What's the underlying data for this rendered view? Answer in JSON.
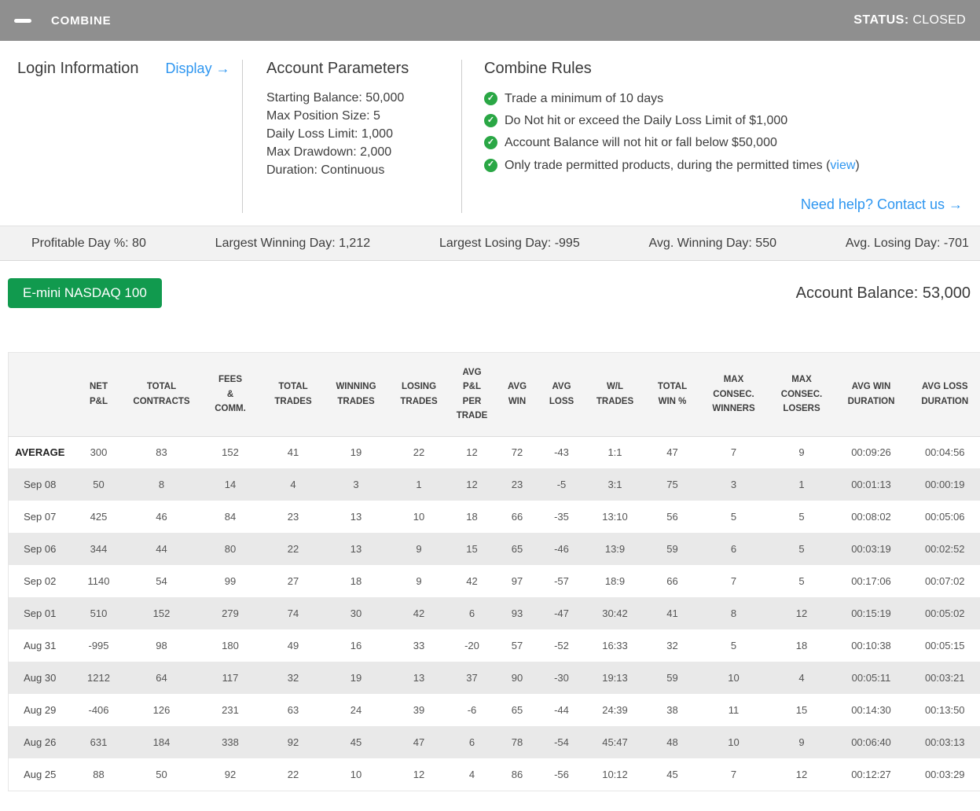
{
  "title_bar": {
    "title": "COMBINE",
    "status_label": "STATUS:",
    "status_value": "CLOSED"
  },
  "icons": {
    "check": "✓",
    "minimize": "—",
    "arrow_right": "→"
  },
  "colors": {
    "topbar_gray": "#8f8f8f",
    "accent_blue": "#2e96f0",
    "button_green": "#119a4e",
    "check_green": "#2aa745"
  },
  "login": {
    "heading": "Login Information",
    "display_link": "Display →"
  },
  "account_parameters": {
    "heading": "Account Parameters",
    "items": [
      "Starting Balance: 50,000",
      "Max Position Size: 5",
      "Daily Loss Limit: 1,000",
      "Max Drawdown: 2,000",
      "Duration: Continuous"
    ]
  },
  "combine_rules": {
    "heading": "Combine Rules",
    "rules": [
      {
        "text": "Trade a minimum of 10 days",
        "link": "",
        "suffix": ""
      },
      {
        "text": "Do Not hit or exceed the Daily Loss Limit of $1,000",
        "link": "",
        "suffix": ""
      },
      {
        "text": "Account Balance will not hit or fall below $50,000",
        "link": "",
        "suffix": ""
      },
      {
        "text": "Only trade permitted products, during the permitted times (",
        "link": "view",
        "suffix": ")"
      }
    ],
    "help_link": "Need help? Contact us →"
  },
  "stats_bar": {
    "items": [
      "Profitable Day %: 80",
      "Largest Winning Day: 1,212",
      "Largest Losing Day: -995",
      "Avg. Winning Day: 550",
      "Avg. Losing Day: -701"
    ]
  },
  "account": {
    "product_button": "E-mini NASDAQ 100",
    "balance": "Account Balance: 53,000"
  },
  "table": {
    "columns": [
      "",
      "NET\nP&L",
      "TOTAL\nCONTRACTS",
      "FEES\n&\nCOMM.",
      "TOTAL\nTRADES",
      "WINNING\nTRADES",
      "LOSING\nTRADES",
      "AVG\nP&L\nPER\nTRADE",
      "AVG\nWIN",
      "AVG\nLOSS",
      "W/L\nTRADES",
      "TOTAL\nWIN %",
      "MAX\nCONSEC.\nWINNERS",
      "MAX\nCONSEC.\nLOSERS",
      "AVG WIN\nDURATION",
      "AVG LOSS\nDURATION"
    ],
    "rows": [
      {
        "label": "AVERAGE",
        "bold": true,
        "values": [
          "300",
          "83",
          "152",
          "41",
          "19",
          "22",
          "12",
          "72",
          "-43",
          "1:1",
          "47",
          "7",
          "9",
          "00:09:26",
          "00:04:56"
        ]
      },
      {
        "label": "Sep 08",
        "bold": false,
        "values": [
          "50",
          "8",
          "14",
          "4",
          "3",
          "1",
          "12",
          "23",
          "-5",
          "3:1",
          "75",
          "3",
          "1",
          "00:01:13",
          "00:00:19"
        ]
      },
      {
        "label": "Sep 07",
        "bold": false,
        "values": [
          "425",
          "46",
          "84",
          "23",
          "13",
          "10",
          "18",
          "66",
          "-35",
          "13:10",
          "56",
          "5",
          "5",
          "00:08:02",
          "00:05:06"
        ]
      },
      {
        "label": "Sep 06",
        "bold": false,
        "values": [
          "344",
          "44",
          "80",
          "22",
          "13",
          "9",
          "15",
          "65",
          "-46",
          "13:9",
          "59",
          "6",
          "5",
          "00:03:19",
          "00:02:52"
        ]
      },
      {
        "label": "Sep 02",
        "bold": false,
        "values": [
          "1140",
          "54",
          "99",
          "27",
          "18",
          "9",
          "42",
          "97",
          "-57",
          "18:9",
          "66",
          "7",
          "5",
          "00:17:06",
          "00:07:02"
        ]
      },
      {
        "label": "Sep 01",
        "bold": false,
        "values": [
          "510",
          "152",
          "279",
          "74",
          "30",
          "42",
          "6",
          "93",
          "-47",
          "30:42",
          "41",
          "8",
          "12",
          "00:15:19",
          "00:05:02"
        ]
      },
      {
        "label": "Aug 31",
        "bold": false,
        "values": [
          "-995",
          "98",
          "180",
          "49",
          "16",
          "33",
          "-20",
          "57",
          "-52",
          "16:33",
          "32",
          "5",
          "18",
          "00:10:38",
          "00:05:15"
        ]
      },
      {
        "label": "Aug 30",
        "bold": false,
        "values": [
          "1212",
          "64",
          "117",
          "32",
          "19",
          "13",
          "37",
          "90",
          "-30",
          "19:13",
          "59",
          "10",
          "4",
          "00:05:11",
          "00:03:21"
        ]
      },
      {
        "label": "Aug 29",
        "bold": false,
        "values": [
          "-406",
          "126",
          "231",
          "63",
          "24",
          "39",
          "-6",
          "65",
          "-44",
          "24:39",
          "38",
          "11",
          "15",
          "00:14:30",
          "00:13:50"
        ]
      },
      {
        "label": "Aug 26",
        "bold": false,
        "values": [
          "631",
          "184",
          "338",
          "92",
          "45",
          "47",
          "6",
          "78",
          "-54",
          "45:47",
          "48",
          "10",
          "9",
          "00:06:40",
          "00:03:13"
        ]
      },
      {
        "label": "Aug 25",
        "bold": false,
        "values": [
          "88",
          "50",
          "92",
          "22",
          "10",
          "12",
          "4",
          "86",
          "-56",
          "10:12",
          "45",
          "7",
          "12",
          "00:12:27",
          "00:03:29"
        ]
      }
    ]
  }
}
